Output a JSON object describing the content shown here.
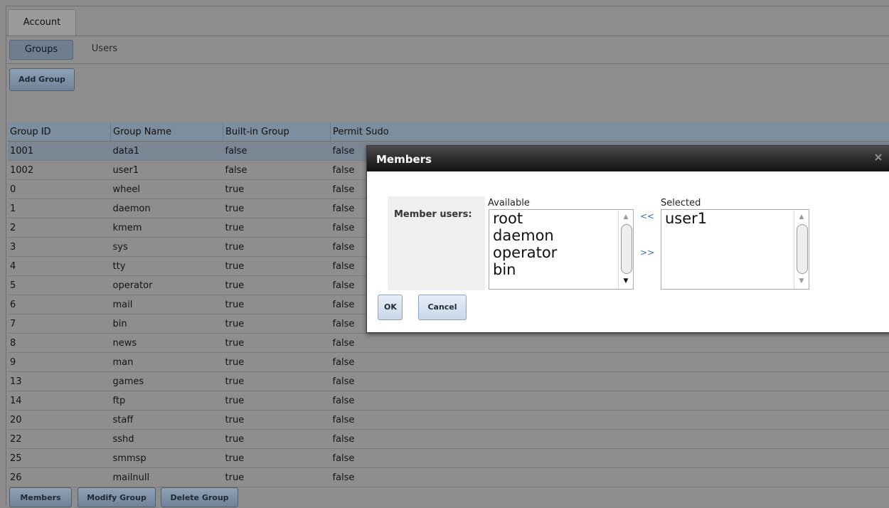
{
  "tabs": {
    "account": "Account"
  },
  "subtabs": {
    "groups": "Groups",
    "users": "Users"
  },
  "toolbar": {
    "add_group": "Add Group"
  },
  "table": {
    "headers": [
      "Group ID",
      "Group Name",
      "Built-in Group",
      "Permit Sudo"
    ],
    "rows": [
      [
        "1001",
        "data1",
        "false",
        "false"
      ],
      [
        "1002",
        "user1",
        "false",
        "false"
      ],
      [
        "0",
        "wheel",
        "true",
        "false"
      ],
      [
        "1",
        "daemon",
        "true",
        "false"
      ],
      [
        "2",
        "kmem",
        "true",
        "false"
      ],
      [
        "3",
        "sys",
        "true",
        "false"
      ],
      [
        "4",
        "tty",
        "true",
        "false"
      ],
      [
        "5",
        "operator",
        "true",
        "false"
      ],
      [
        "6",
        "mail",
        "true",
        "false"
      ],
      [
        "7",
        "bin",
        "true",
        "false"
      ],
      [
        "8",
        "news",
        "true",
        "false"
      ],
      [
        "9",
        "man",
        "true",
        "false"
      ],
      [
        "13",
        "games",
        "true",
        "false"
      ],
      [
        "14",
        "ftp",
        "true",
        "false"
      ],
      [
        "20",
        "staff",
        "true",
        "false"
      ],
      [
        "22",
        "sshd",
        "true",
        "false"
      ],
      [
        "25",
        "smmsp",
        "true",
        "false"
      ],
      [
        "26",
        "mailnull",
        "true",
        "false"
      ]
    ]
  },
  "bottom_buttons": {
    "members": "Members",
    "modify": "Modify Group",
    "delete": "Delete Group"
  },
  "dialog": {
    "title": "Members",
    "close_icon": "close-icon",
    "member_users_label": "Member users:",
    "available_caption": "Available",
    "selected_caption": "Selected",
    "available": [
      "root",
      "daemon",
      "operator",
      "bin"
    ],
    "selected": [
      "user1"
    ],
    "move_left": "<<",
    "move_right": ">>",
    "ok": "OK",
    "cancel": "Cancel"
  }
}
